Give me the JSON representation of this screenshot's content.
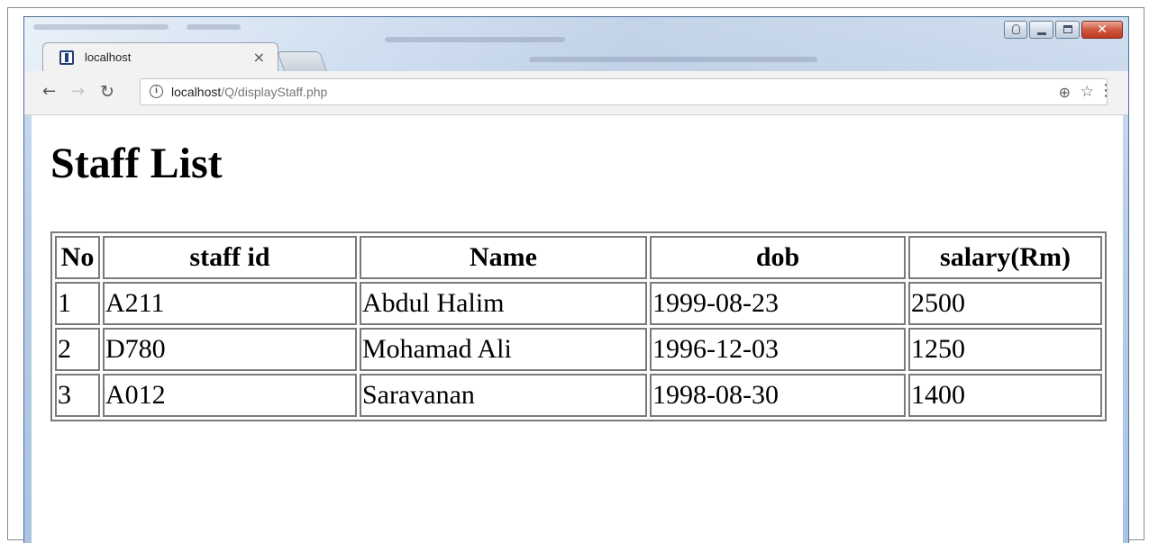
{
  "browser": {
    "tab": {
      "title": "localhost",
      "close_glyph": "×"
    },
    "address": {
      "host": "localhost",
      "path": "/Q/displayStaff.php"
    },
    "icons": {
      "back": "arrow-left",
      "forward": "arrow-right",
      "reload": "reload",
      "info": "info",
      "zoom": "zoom-in",
      "bookmark": "star",
      "menu": "more-vertical",
      "window_close": "x"
    }
  },
  "page": {
    "title": "Staff List",
    "table": {
      "headers": [
        "No",
        "staff id",
        "Name",
        "dob",
        "salary(Rm)"
      ],
      "rows": [
        [
          "1",
          "A211",
          "Abdul Halim",
          "1999-08-23",
          "2500"
        ],
        [
          "2",
          "D780",
          "Mohamad Ali",
          "1996-12-03",
          "1250"
        ],
        [
          "3",
          "A012",
          "Saravanan",
          "1998-08-30",
          "1400"
        ]
      ]
    }
  }
}
